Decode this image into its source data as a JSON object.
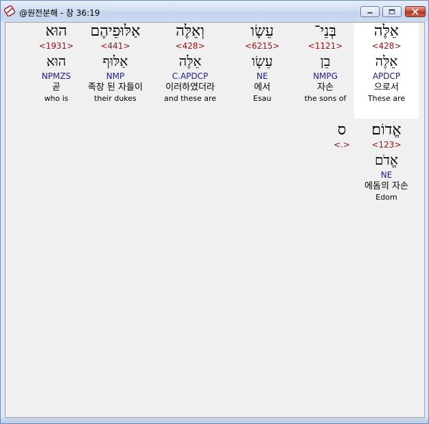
{
  "window": {
    "title": "@원전분해 - 창 36:19"
  },
  "words": [
    {
      "hebrew": "אֵלֶּה",
      "strong": "<428>",
      "lemma": "אֵלֶּה",
      "morph": "APDCP",
      "korean": "으로서",
      "english": "These are"
    },
    {
      "hebrew": "בְּנֵי־",
      "strong": "<1121>",
      "lemma": "בֵן",
      "morph": "NMPG",
      "korean": "자손",
      "english": "the sons of"
    },
    {
      "hebrew": "עֵשָׂו",
      "strong": "<6215>",
      "lemma": "עֵשָׂו",
      "morph": "NE",
      "korean": "에서",
      "english": "Esau"
    },
    {
      "hebrew": "וְאֵלֶּה",
      "strong": "<428>",
      "lemma": "אֵלֶּה",
      "morph": "C.APDCP",
      "korean": "이러하였더라",
      "english": "and these are"
    },
    {
      "hebrew": "אַלּוּפֵיהֶם",
      "strong": "<441>",
      "lemma": "אַלּוּף",
      "morph": "NMP",
      "korean": "족장 된 자들이",
      "english": "their dukes"
    },
    {
      "hebrew": "הוּא",
      "strong": "<1931>",
      "lemma": "הוּא",
      "morph": "NPMZS",
      "korean": "곧",
      "english": "who is"
    },
    {
      "hebrew": "אֱדוֹם׃",
      "strong": "<123>",
      "lemma": "אֱדֹם",
      "morph": "NE",
      "korean": "에돔의 자손",
      "english": "Edom"
    },
    {
      "hebrew": "ס",
      "strong": "<.>",
      "lemma": "",
      "morph": "",
      "korean": "",
      "english": ""
    }
  ],
  "colors": {
    "strong": "#a01010",
    "morph": "#1a1aa8",
    "selected_bg": "#ffffff"
  },
  "icons": [
    "app-icon",
    "minimize-icon",
    "maximize-icon",
    "close-icon"
  ]
}
